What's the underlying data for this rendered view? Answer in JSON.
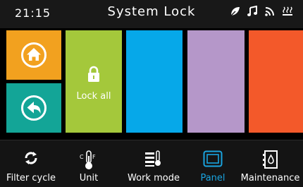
{
  "header": {
    "time": "21:15",
    "title": "System Lock",
    "status_icons": [
      "leaf-icon",
      "music-icon",
      "wifi-icon",
      "heater-icon"
    ]
  },
  "side_buttons": [
    {
      "name": "home",
      "icon": "home-icon",
      "color": "#f2a11f"
    },
    {
      "name": "back",
      "icon": "back-icon",
      "color": "#13a597"
    }
  ],
  "tiles": [
    {
      "name": "lock-all",
      "label": "Lock all",
      "icon": "lock-icon",
      "color": "#a4c83b"
    },
    {
      "name": "blue",
      "label": "",
      "color": "#06a8e9"
    },
    {
      "name": "purple",
      "label": "",
      "color": "#b597c9"
    },
    {
      "name": "orange",
      "label": "",
      "color": "#f3592a"
    }
  ],
  "nav": {
    "items": [
      {
        "label": "Filter cycle",
        "icon": "refresh-icon",
        "active": false
      },
      {
        "label": "Unit",
        "icon": "thermometer-icon",
        "active": false
      },
      {
        "label": "Work mode",
        "icon": "work-mode-icon",
        "active": false
      },
      {
        "label": "Panel",
        "icon": "panel-icon",
        "active": true
      },
      {
        "label": "Maintenance",
        "icon": "maintenance-icon",
        "active": false
      }
    ],
    "active_color": "#1aa4df"
  }
}
